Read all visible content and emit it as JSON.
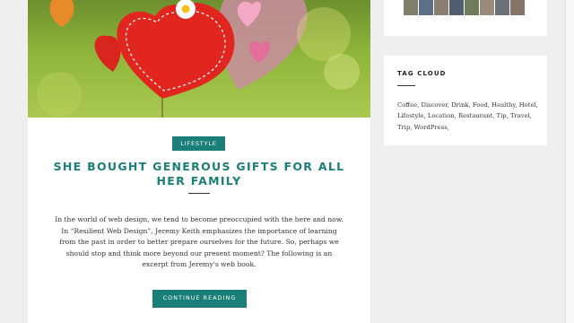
{
  "post": {
    "category": "LIFESTYLE",
    "title": "SHE BOUGHT GENEROUS GIFTS FOR ALL HER FAMILY",
    "excerpt": "In the world of web design, we tend to become preoccupied with the here and now. In “Resilient Web Design”, Jeremy Keith emphasizes the importance of learning from the past in order to better prepare ourselves for the future. So, perhaps we should stop and think more beyond our present moment? The following is an excerpt from Jeremy's web book.",
    "cta_label": "CONTINUE READING"
  },
  "sidebar": {
    "tag_cloud": {
      "title": "TAG CLOUD",
      "tags": [
        "Coffee,",
        "Discover,",
        "Drink,",
        "Food,",
        "Healthy,",
        "Hotel,",
        "Lifestyle,",
        "Location,",
        "Restaurant,",
        "Tip,",
        "Travel,",
        "Trip,",
        "WordPress,"
      ]
    }
  },
  "colors": {
    "accent": "#1a7f78",
    "background": "#efefef",
    "card": "#ffffff",
    "text": "#333333"
  }
}
